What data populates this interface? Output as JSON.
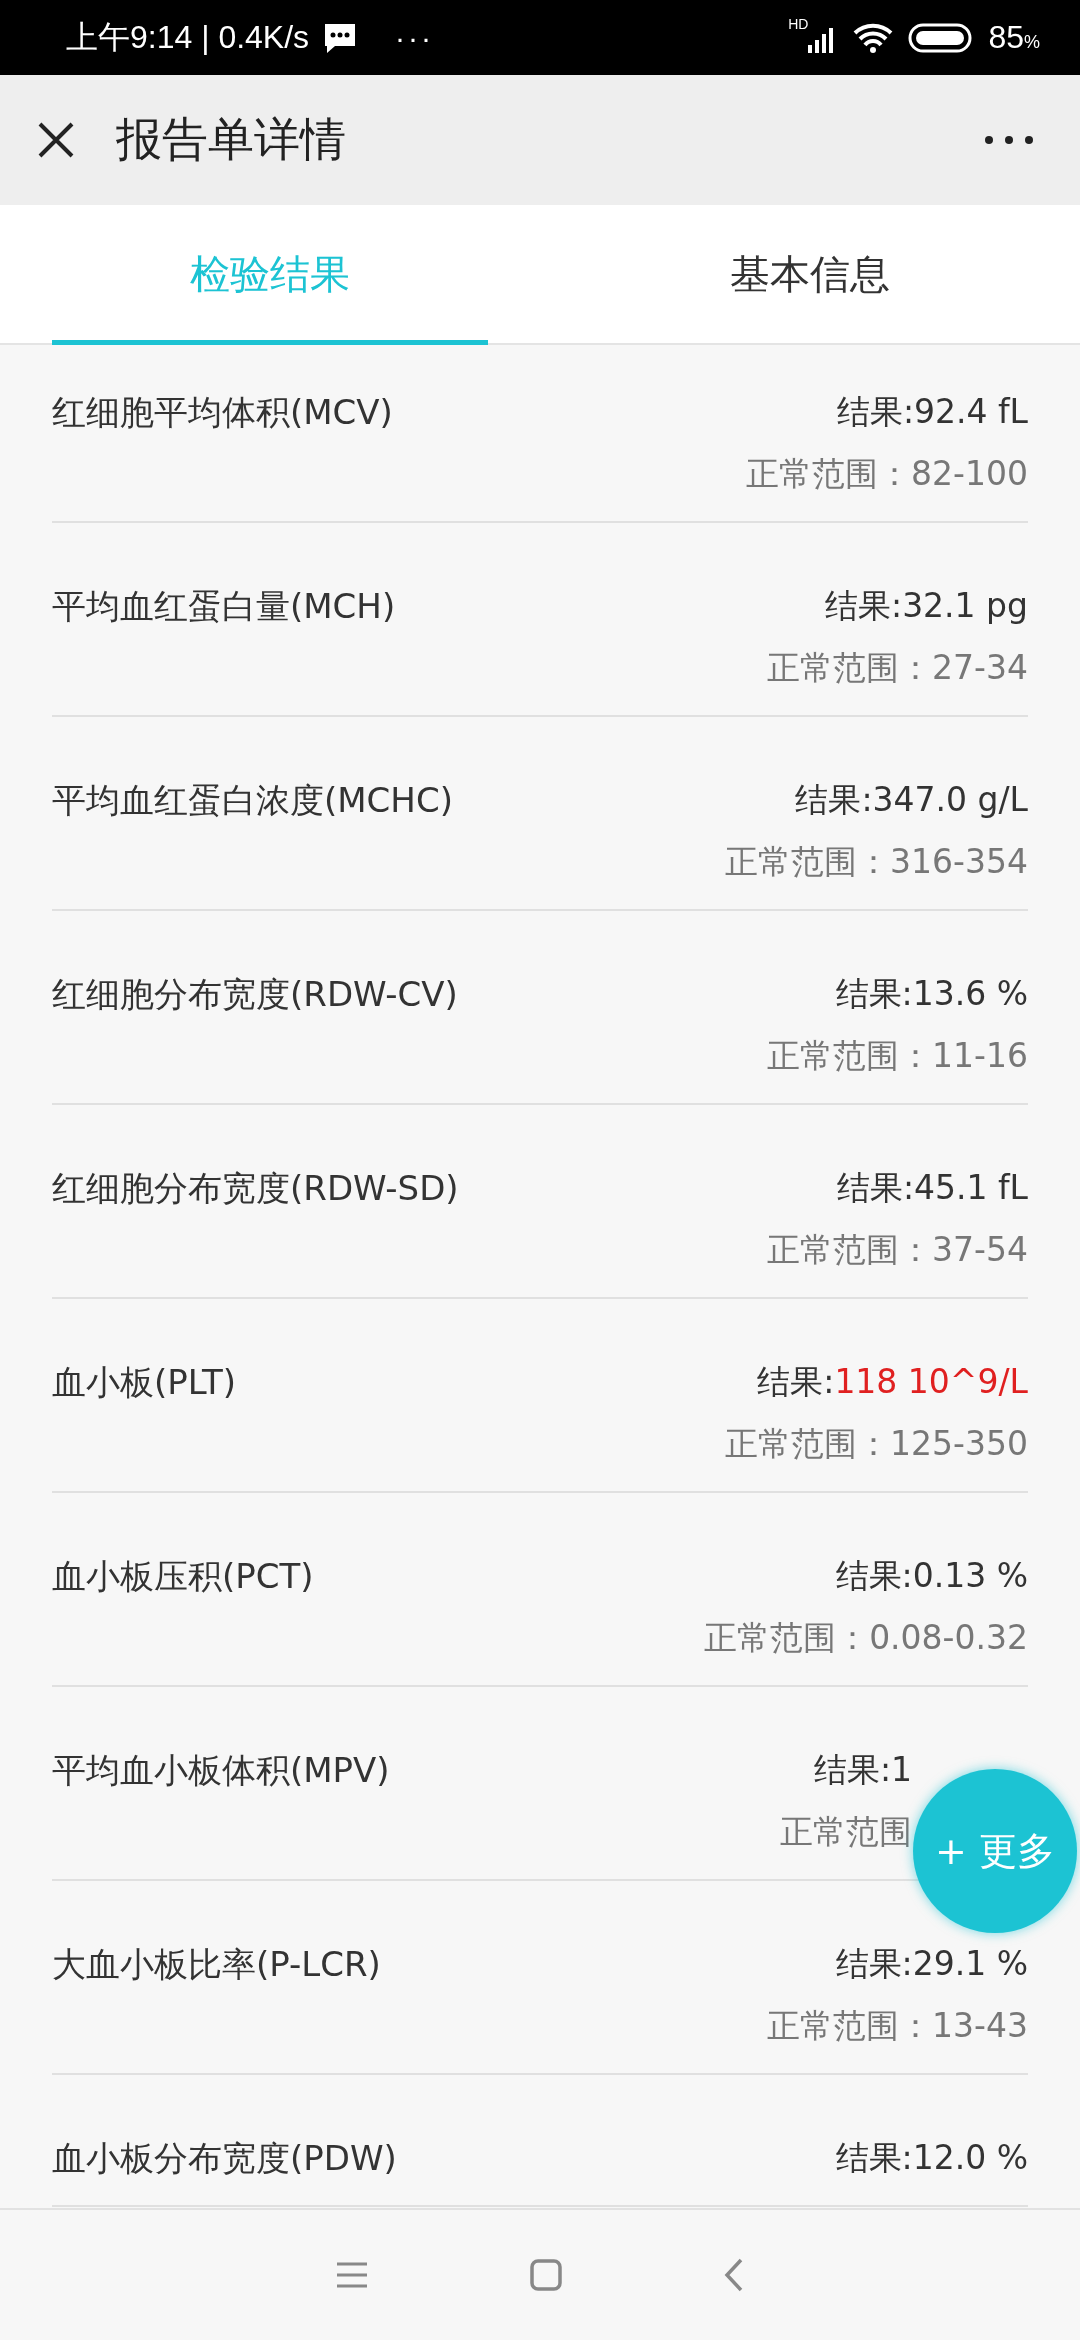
{
  "status_bar": {
    "time": "上午9:14 | 0.4K/s",
    "more": "···",
    "network": "HD",
    "battery": "85",
    "battery_unit": "%"
  },
  "header": {
    "title": "报告单详情"
  },
  "tabs": [
    {
      "label": "检验结果",
      "selected": true
    },
    {
      "label": "基本信息",
      "selected": false
    }
  ],
  "results": [
    {
      "name": "红细胞平均体积(MCV)",
      "result_label": "结果:",
      "result_value": "92.4 fL",
      "abnormal": false,
      "range": "正常范围：82-100"
    },
    {
      "name": "平均血红蛋白量(MCH)",
      "result_label": "结果:",
      "result_value": "32.1 pg",
      "abnormal": false,
      "range": "正常范围：27-34"
    },
    {
      "name": "平均血红蛋白浓度(MCHC)",
      "result_label": "结果:",
      "result_value": "347.0 g/L",
      "abnormal": false,
      "range": "正常范围：316-354"
    },
    {
      "name": "红细胞分布宽度(RDW-CV)",
      "result_label": "结果:",
      "result_value": "13.6 %",
      "abnormal": false,
      "range": "正常范围：11-16"
    },
    {
      "name": "红细胞分布宽度(RDW-SD)",
      "result_label": "结果:",
      "result_value": "45.1 fL",
      "abnormal": false,
      "range": "正常范围：37-54"
    },
    {
      "name": "血小板(PLT)",
      "result_label": "结果:",
      "result_value": "118 10^9/L",
      "abnormal": true,
      "range": "正常范围：125-350"
    },
    {
      "name": "血小板压积(PCT)",
      "result_label": "结果:",
      "result_value": "0.13 %",
      "abnormal": false,
      "range": "正常范围：0.08-0.32"
    },
    {
      "name": "平均血小板体积(MPV)",
      "result_label": "结果:",
      "result_value": "1",
      "abnormal": false,
      "range": "正常范围",
      "obscured": true
    },
    {
      "name": "大血小板比率(P-LCR)",
      "result_label": "结果:",
      "result_value": "29.1 %",
      "abnormal": false,
      "range": "正常范围：13-43"
    },
    {
      "name": "血小板分布宽度(PDW)",
      "result_label": "结果:",
      "result_value": "12.0 %",
      "abnormal": false
    }
  ],
  "fab": {
    "label": "+ 更多"
  }
}
